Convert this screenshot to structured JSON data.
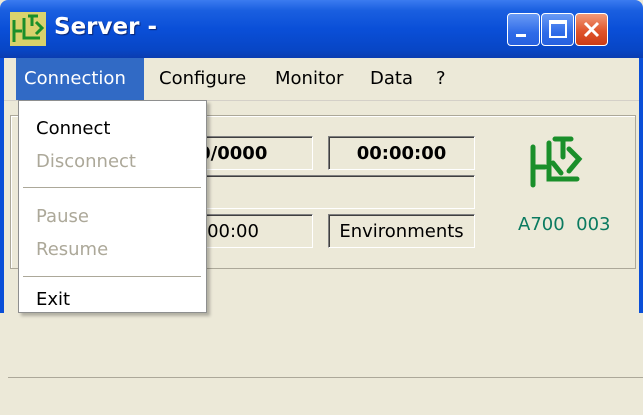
{
  "window": {
    "title": "Server  -",
    "icon": "plotter-icon",
    "controls": [
      "minimize-icon",
      "maximize-icon",
      "close-icon"
    ]
  },
  "menubar": {
    "items": [
      {
        "label": "Connection"
      },
      {
        "label": "Configure"
      },
      {
        "label": "Monitor"
      },
      {
        "label": "Data"
      },
      {
        "label": "?"
      }
    ]
  },
  "connection_menu": {
    "items": [
      {
        "label": "Connect",
        "enabled": true
      },
      {
        "label": "Disconnect",
        "enabled": false
      },
      {
        "label": "Pause",
        "enabled": false
      },
      {
        "label": "Resume",
        "enabled": false
      },
      {
        "label": "Exit",
        "enabled": true
      }
    ]
  },
  "status": {
    "date_value": "00/0000",
    "time_value": "00:00:00",
    "elapsed_value": ":00:00",
    "environments_label": "Environments"
  },
  "device": {
    "label": "A700  003"
  },
  "colors": {
    "title_bar": "#0a4fd8",
    "menu_highlight": "#316ac5",
    "logo_green": "#1a8f2a",
    "label_teal": "#0a7a60"
  }
}
